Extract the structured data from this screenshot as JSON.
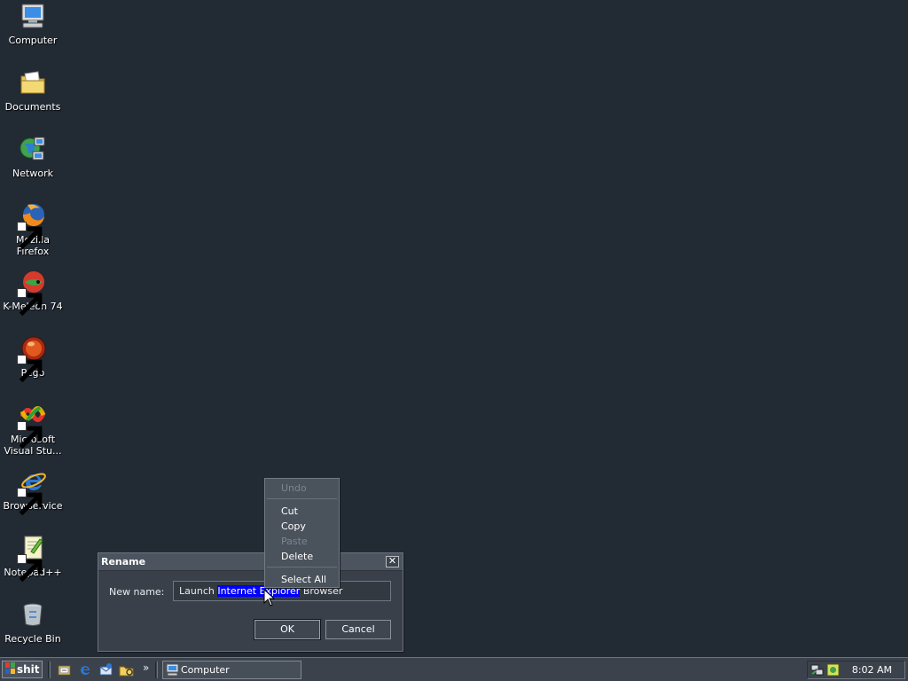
{
  "desktop": {
    "icons": [
      {
        "label": "Computer",
        "icon": "computer-icon",
        "shortcut": false
      },
      {
        "label": "Documents",
        "icon": "documents-folder-icon",
        "shortcut": false
      },
      {
        "label": "Network",
        "icon": "network-icon",
        "shortcut": false
      },
      {
        "label": "Mozilla Firefox",
        "icon": "firefox-icon",
        "shortcut": true
      },
      {
        "label": "K-Meleon 74",
        "icon": "k-meleon-icon",
        "shortcut": true
      },
      {
        "label": "Pego",
        "icon": "pego-icon",
        "shortcut": true
      },
      {
        "label": "Microsoft Visual Stu...",
        "icon": "visual-studio-icon",
        "shortcut": true
      },
      {
        "label": "Browservice",
        "icon": "internet-explorer-icon",
        "shortcut": true
      },
      {
        "label": "Notepad++",
        "icon": "notepad-plus-plus-icon",
        "shortcut": true
      },
      {
        "label": "Recycle Bin",
        "icon": "recycle-bin-icon",
        "shortcut": false
      }
    ]
  },
  "rename_dialog": {
    "title": "Rename",
    "close_glyph": "✕",
    "field_label": "New name:",
    "value_before": "Launch ",
    "value_selected": "Internet Explorer",
    "value_after": " Browser",
    "ok_label": "OK",
    "cancel_label": "Cancel"
  },
  "context_menu": {
    "items": [
      {
        "label": "Undo",
        "enabled": false
      },
      {
        "label": "Cut",
        "enabled": true
      },
      {
        "label": "Copy",
        "enabled": true
      },
      {
        "label": "Paste",
        "enabled": false
      },
      {
        "label": "Delete",
        "enabled": true
      },
      {
        "label": "Select All",
        "enabled": true
      }
    ]
  },
  "taskbar": {
    "start_label": "shit",
    "quick_launch": [
      "show-desktop-icon",
      "internet-explorer-icon",
      "outlook-express-icon",
      "explorer-folder-icon"
    ],
    "chevron": "»",
    "task_label": "Computer",
    "tray_icons": [
      "network-tray-icon",
      "app-tray-icon"
    ],
    "clock": "8:02 AM"
  },
  "colors": {
    "desktop_bg": "#222a33",
    "selection": "#0000ff"
  }
}
